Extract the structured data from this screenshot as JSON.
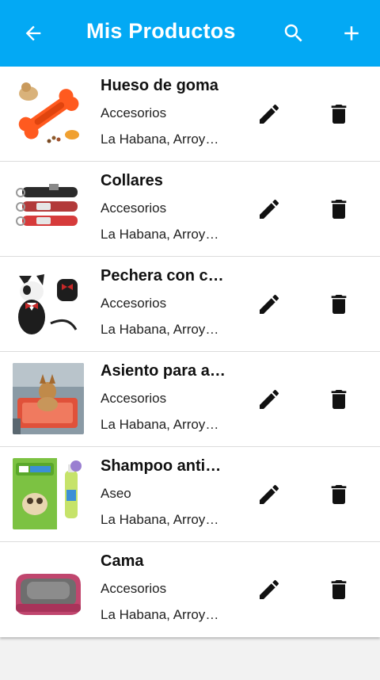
{
  "appbar": {
    "title": "Mis Productos",
    "back_icon": "arrow-left-icon",
    "search_icon": "search-icon",
    "add_icon": "plus-icon",
    "color": "#03A9F4"
  },
  "products": [
    {
      "name": "Hueso de goma",
      "category": "Accesorios",
      "location": "La Habana, Arroyo Naranjo",
      "image": "rubber-bone-dog-photo"
    },
    {
      "name": "Collares",
      "category": "Accesorios",
      "location": "La Habana, Arroyo Naranjo",
      "image": "dog-collars-photo"
    },
    {
      "name": "Pechera con corbata",
      "category": "Accesorios",
      "location": "La Habana, Arroyo Naranjo",
      "image": "dog-harness-photo"
    },
    {
      "name": "Asiento para auto",
      "category": "Accesorios",
      "location": "La Habana, Arroyo Naranjo",
      "image": "dog-car-seat-photo"
    },
    {
      "name": "Shampoo antipulgas",
      "category": "Aseo",
      "location": "La Habana, Arroyo Naranjo",
      "image": "pet-shampoo-photo"
    },
    {
      "name": "Cama",
      "category": "Accesorios",
      "location": "La Habana, Arroyo Naranjo",
      "image": "pet-bed-photo"
    }
  ],
  "row_actions": {
    "edit_icon": "pencil-icon",
    "delete_icon": "trash-icon"
  }
}
